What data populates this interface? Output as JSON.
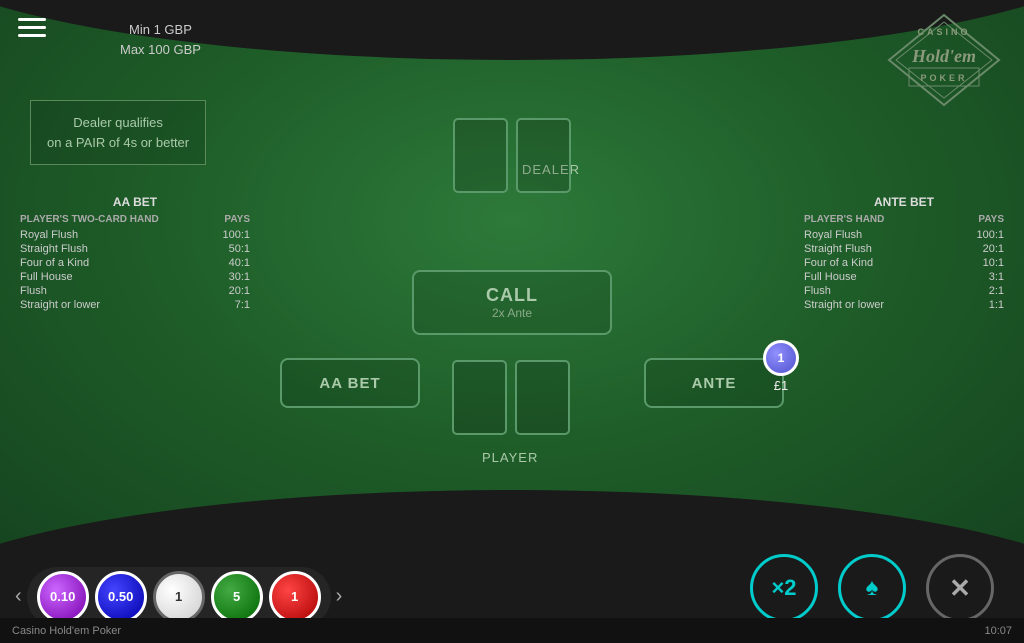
{
  "table": {
    "bet_limits": {
      "min": "Min 1 GBP",
      "max": "Max 100 GBP"
    },
    "dealer_qualifies_text": "Dealer qualifies\non a PAIR of 4s or better",
    "dealer_label": "DEALER",
    "player_label": "PLAYER",
    "call_button": {
      "label": "CALL",
      "sub": "2x Ante"
    },
    "aa_bet_label": "AA BET",
    "ante_label": "ANTE",
    "chip_value": "£1"
  },
  "logo": {
    "casino": "CASINO",
    "holdem": "Hold'em",
    "poker": "POKER"
  },
  "aa_paytable": {
    "title": "AA BET",
    "header_hand": "PLAYER'S TWO-CARD HAND",
    "header_pays": "PAYS",
    "rows": [
      {
        "hand": "Royal Flush",
        "pays": "100:1"
      },
      {
        "hand": "Straight Flush",
        "pays": "50:1"
      },
      {
        "hand": "Four of a Kind",
        "pays": "40:1"
      },
      {
        "hand": "Full House",
        "pays": "30:1"
      },
      {
        "hand": "Flush",
        "pays": "20:1"
      },
      {
        "hand": "Straight or lower",
        "pays": "7:1"
      }
    ]
  },
  "ante_paytable": {
    "title": "ANTE BET",
    "header_hand": "PLAYER'S HAND",
    "header_pays": "PAYS",
    "rows": [
      {
        "hand": "Royal Flush",
        "pays": "100:1"
      },
      {
        "hand": "Straight Flush",
        "pays": "20:1"
      },
      {
        "hand": "Four of a Kind",
        "pays": "10:1"
      },
      {
        "hand": "Full House",
        "pays": "3:1"
      },
      {
        "hand": "Flush",
        "pays": "2:1"
      },
      {
        "hand": "Straight or lower",
        "pays": "1:1"
      }
    ]
  },
  "chips": [
    {
      "label": "0.10",
      "class": "chip-0-10"
    },
    {
      "label": "0.50",
      "class": "chip-0-50"
    },
    {
      "label": "1",
      "class": "chip-1"
    },
    {
      "label": "5",
      "class": "chip-5"
    },
    {
      "label": "1",
      "class": "chip-1b"
    }
  ],
  "action_buttons": {
    "double_bet": {
      "label": "Double Bet",
      "symbol": "×2"
    },
    "deal": {
      "label": "Deal",
      "symbol": "♠"
    },
    "clear_bets": {
      "label": "Clear Bets",
      "symbol": "✕"
    }
  },
  "status_bar": {
    "game_name": "Casino Hold'em Poker",
    "time": "10:07"
  },
  "ante_chip": {
    "value": "1",
    "amount": "£1"
  }
}
